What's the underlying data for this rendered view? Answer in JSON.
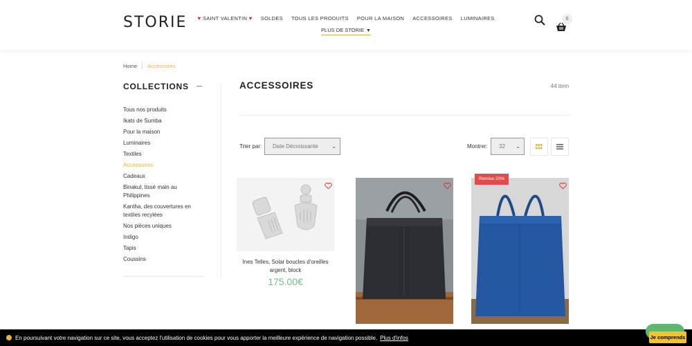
{
  "header": {
    "logo": "STORIE",
    "nav": [
      {
        "label": "SAINT VALENTIN",
        "hearts": true
      },
      {
        "label": "SOLDES"
      },
      {
        "label": "TOUS LES PRODUITS"
      },
      {
        "label": "POUR LA MAISON"
      },
      {
        "label": "ACCESSOIRES"
      },
      {
        "label": "LUMINAIRES"
      }
    ],
    "nav_more": "PLUS DE STORIE",
    "cart_count": "0"
  },
  "breadcrumb": {
    "home": "Home",
    "current": "Accessoires"
  },
  "sidebar": {
    "title": "COLLECTIONS",
    "items": [
      "Tous nos produits",
      "Ikats de Sumba",
      "Pour la maison",
      "Luminaires",
      "Textiles",
      "Accessoires",
      "Cadeaux",
      "Binakul, tissé main au Philippines",
      "Kantha, des couvertures en textiles recylées",
      "Nos pièces uniques",
      "Indigo",
      "Tapis",
      "Coussins"
    ],
    "active_index": 5
  },
  "main": {
    "title": "ACCESSOIRES",
    "item_count": "44 item",
    "sort_label": "Trier par:",
    "sort_value": "Date Décroissante",
    "show_label": "Montrer:",
    "show_value": "32"
  },
  "products": [
    {
      "name": "Ines Telles, Solar boucles d'oreilles argent, block",
      "price": "175.00€",
      "badge": ""
    },
    {
      "name": "",
      "price": "",
      "badge": ""
    },
    {
      "name": "",
      "price": "",
      "badge": "Remise 20%"
    }
  ],
  "cookie": {
    "text": "En poursuivant votre navigation sur ce site, vous acceptez l'utilisation de cookies pour vous apporter la meilleure expérience de navigation possible.",
    "link": "Plus d'infos",
    "button": "Je comprends"
  },
  "colors": {
    "accent": "#e7b33c",
    "price": "#6fbf8a",
    "badge": "#e04b4b",
    "heart": "#c0392b"
  }
}
